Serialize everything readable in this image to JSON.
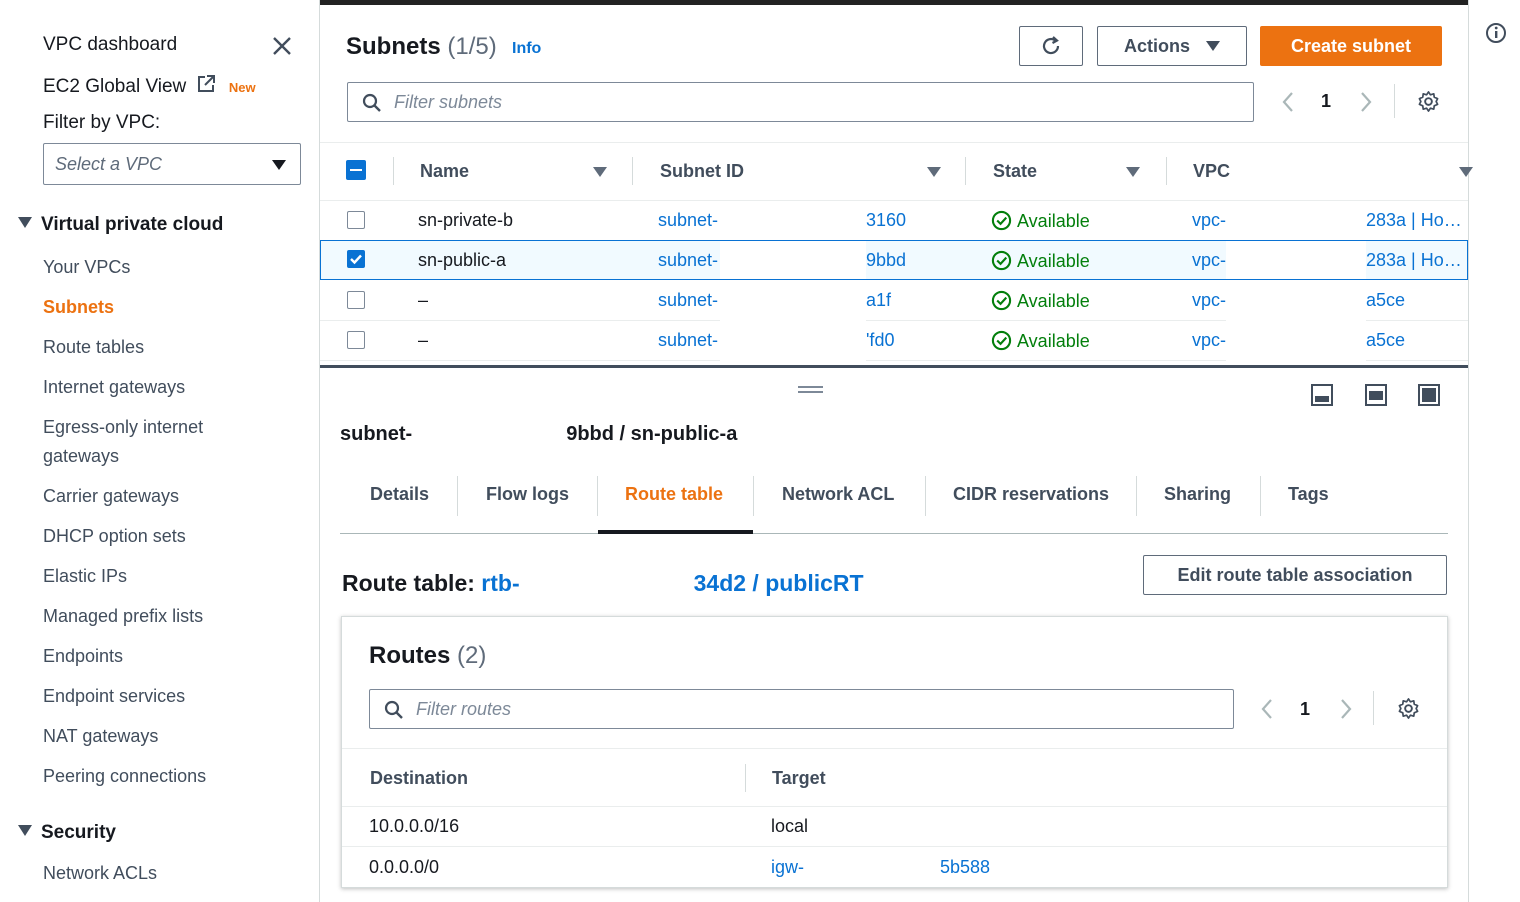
{
  "sidebar": {
    "dashboard": "VPC dashboard",
    "ec2_global_view": "EC2 Global View",
    "new_badge": "New",
    "filter_label": "Filter by VPC:",
    "vpc_select_placeholder": "Select a VPC",
    "section_vpc": "Virtual private cloud",
    "items": [
      "Your VPCs",
      "Subnets",
      "Route tables",
      "Internet gateways",
      "Egress-only internet",
      "gateways",
      "Carrier gateways",
      "DHCP option sets",
      "Elastic IPs",
      "Managed prefix lists",
      "Endpoints",
      "Endpoint services",
      "NAT gateways",
      "Peering connections"
    ],
    "section_security": "Security",
    "security_items": [
      "Network ACLs"
    ]
  },
  "header": {
    "title": "Subnets",
    "count": "(1/5)",
    "info": "Info",
    "actions_label": "Actions",
    "create_label": "Create subnet",
    "filter_placeholder": "Filter subnets",
    "page": "1"
  },
  "table": {
    "columns": [
      "Name",
      "Subnet ID",
      "State",
      "VPC"
    ],
    "rows": [
      {
        "name": "sn-private-b",
        "subnet_prefix": "subnet-",
        "subnet_suffix": "3160",
        "state": "Available",
        "vpc_prefix": "vpc-",
        "vpc_suffix": "283a | Ho…",
        "checked": false
      },
      {
        "name": "sn-public-a",
        "subnet_prefix": "subnet-",
        "subnet_suffix": "9bbd",
        "state": "Available",
        "vpc_prefix": "vpc-",
        "vpc_suffix": "283a | Ho…",
        "checked": true
      },
      {
        "name": "–",
        "subnet_prefix": "subnet-",
        "subnet_suffix": "a1f",
        "state": "Available",
        "vpc_prefix": "vpc-",
        "vpc_suffix": "a5ce",
        "checked": false
      },
      {
        "name": "–",
        "subnet_prefix": "subnet-",
        "subnet_suffix": "'fd0",
        "state": "Available",
        "vpc_prefix": "vpc-",
        "vpc_suffix": "a5ce",
        "checked": false
      }
    ]
  },
  "detail": {
    "title_prefix": "subnet-",
    "title_suffix": "9bbd / sn-public-a",
    "tabs": [
      "Details",
      "Flow logs",
      "Route table",
      "Network ACL",
      "CIDR reservations",
      "Sharing",
      "Tags"
    ],
    "route_table_label": "Route table:",
    "route_table_prefix": "rtb-",
    "route_table_suffix": "34d2 / publicRT",
    "edit_label": "Edit route table association",
    "routes_title": "Routes",
    "routes_count": "(2)",
    "routes_filter_placeholder": "Filter routes",
    "routes_page": "1",
    "route_columns": [
      "Destination",
      "Target"
    ],
    "routes": [
      {
        "destination": "10.0.0.0/16",
        "target": "local"
      },
      {
        "destination": "0.0.0.0/0",
        "target_prefix": "igw-",
        "target_suffix": "5b588"
      }
    ]
  },
  "colors": {
    "accent": "#ec7211",
    "link": "#0972d3",
    "available": "#037f0c"
  }
}
